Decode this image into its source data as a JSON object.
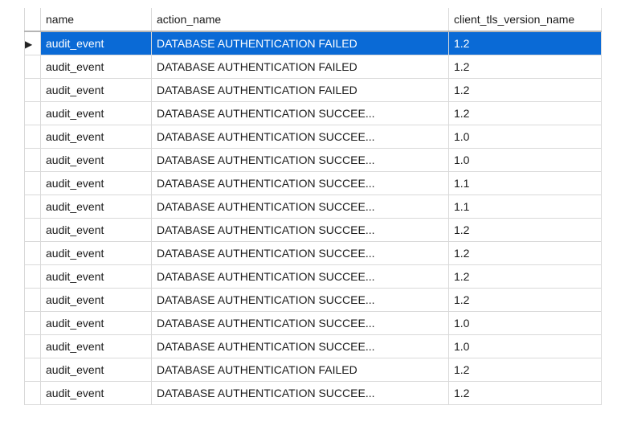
{
  "grid": {
    "columns": {
      "name": "name",
      "action_name": "action_name",
      "client_tls_version_name": "client_tls_version_name"
    },
    "selected_row_index": 0,
    "rows": [
      {
        "name": "audit_event",
        "action_name": "DATABASE AUTHENTICATION FAILED",
        "tls": "1.2"
      },
      {
        "name": "audit_event",
        "action_name": "DATABASE AUTHENTICATION FAILED",
        "tls": "1.2"
      },
      {
        "name": "audit_event",
        "action_name": "DATABASE AUTHENTICATION FAILED",
        "tls": "1.2"
      },
      {
        "name": "audit_event",
        "action_name": "DATABASE AUTHENTICATION SUCCEE...",
        "tls": "1.2"
      },
      {
        "name": "audit_event",
        "action_name": "DATABASE AUTHENTICATION SUCCEE...",
        "tls": "1.0"
      },
      {
        "name": "audit_event",
        "action_name": "DATABASE AUTHENTICATION SUCCEE...",
        "tls": "1.0"
      },
      {
        "name": "audit_event",
        "action_name": "DATABASE AUTHENTICATION SUCCEE...",
        "tls": "1.1"
      },
      {
        "name": "audit_event",
        "action_name": "DATABASE AUTHENTICATION SUCCEE...",
        "tls": "1.1"
      },
      {
        "name": "audit_event",
        "action_name": "DATABASE AUTHENTICATION SUCCEE...",
        "tls": "1.2"
      },
      {
        "name": "audit_event",
        "action_name": "DATABASE AUTHENTICATION SUCCEE...",
        "tls": "1.2"
      },
      {
        "name": "audit_event",
        "action_name": "DATABASE AUTHENTICATION SUCCEE...",
        "tls": "1.2"
      },
      {
        "name": "audit_event",
        "action_name": "DATABASE AUTHENTICATION SUCCEE...",
        "tls": "1.2"
      },
      {
        "name": "audit_event",
        "action_name": "DATABASE AUTHENTICATION SUCCEE...",
        "tls": "1.0"
      },
      {
        "name": "audit_event",
        "action_name": "DATABASE AUTHENTICATION SUCCEE...",
        "tls": "1.0"
      },
      {
        "name": "audit_event",
        "action_name": "DATABASE AUTHENTICATION FAILED",
        "tls": "1.2"
      },
      {
        "name": "audit_event",
        "action_name": "DATABASE AUTHENTICATION SUCCEE...",
        "tls": "1.2"
      }
    ]
  }
}
